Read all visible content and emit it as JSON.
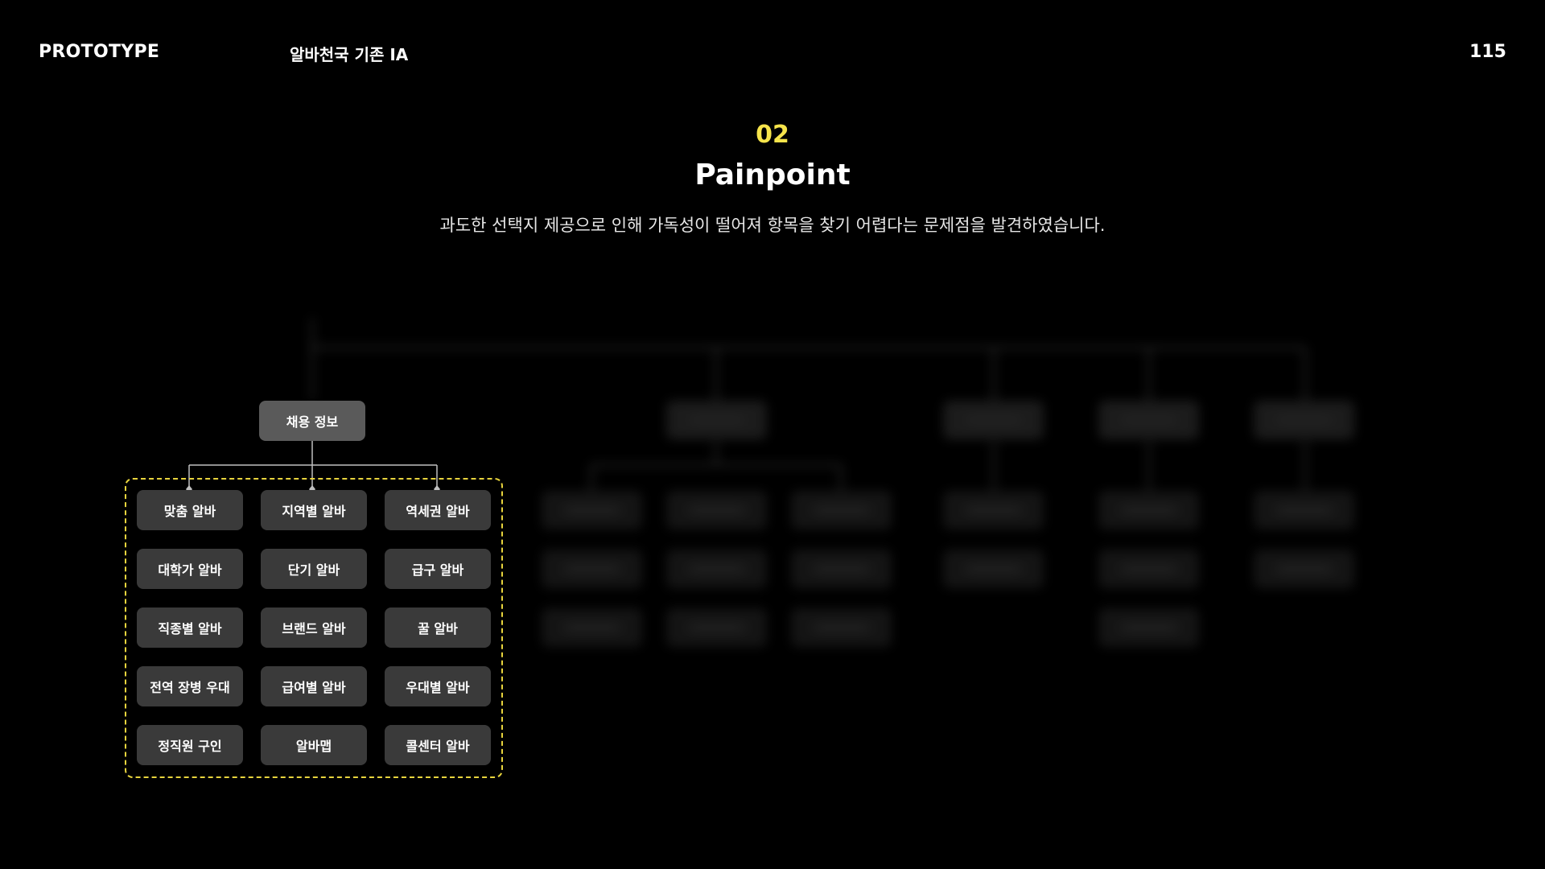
{
  "header": {
    "left": "PROTOTYPE",
    "title": "알바천국 기존 IA",
    "page_number": "115"
  },
  "section": {
    "number": "02",
    "title": "Painpoint",
    "description": "과도한 선택지 제공으로 인해 가독성이 떨어져 항목을 찾기 어렵다는 문제점을 발견하였습니다."
  },
  "diagram": {
    "root": "채용 정보",
    "items": [
      "맞춤 알바",
      "지역별 알바",
      "역세권 알바",
      "대학가 알바",
      "단기 알바",
      "급구 알바",
      "직종별 알바",
      "브랜드 알바",
      "꿀 알바",
      "전역 장병 우대",
      "급여별 알바",
      "우대별 알바",
      "정직원 구인",
      "알바맵",
      "콜센터 알바"
    ],
    "highlight_color": "#e8d43d",
    "accent_color": "#f6e44b"
  }
}
